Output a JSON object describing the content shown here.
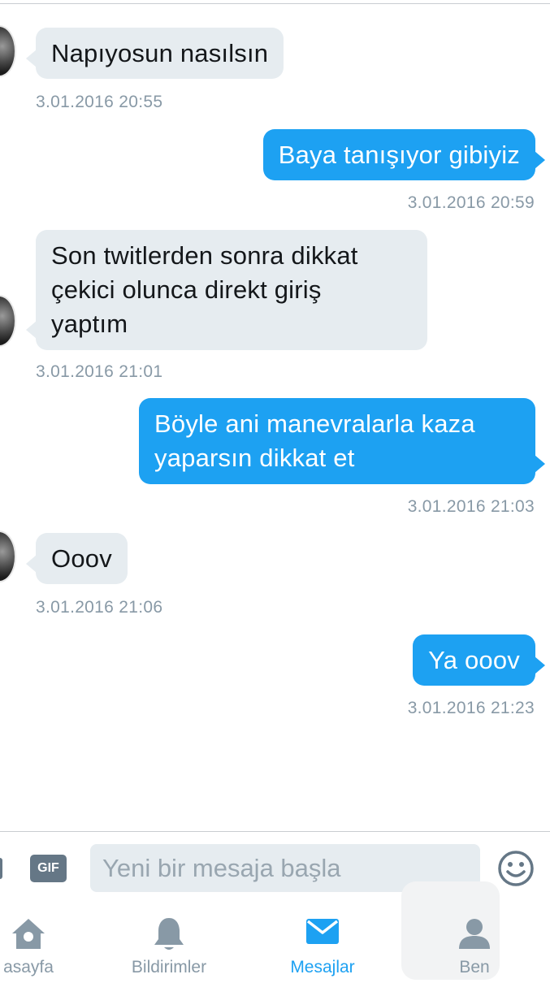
{
  "messages": [
    {
      "direction": "in",
      "lines": [
        "Napıyosun nasılsın"
      ],
      "time": "3.01.2016 20:55"
    },
    {
      "direction": "out",
      "lines": [
        "Baya tanışıyor gibiyiz"
      ],
      "time": "3.01.2016 20:59"
    },
    {
      "direction": "in",
      "lines": [
        "Son twitlerden sonra dikkat",
        "çekici olunca direkt giriş",
        "yaptım"
      ],
      "time": "3.01.2016 21:01"
    },
    {
      "direction": "out",
      "lines": [
        "Böyle ani manevralarla kaza",
        "yaparsın dikkat et"
      ],
      "time": "3.01.2016 21:03"
    },
    {
      "direction": "in",
      "lines": [
        "Ooov"
      ],
      "time": "3.01.2016 21:06"
    },
    {
      "direction": "out",
      "lines": [
        "Ya ooov"
      ],
      "time": "3.01.2016 21:23"
    }
  ],
  "composer": {
    "gif_label": "GIF",
    "placeholder": "Yeni bir mesaja başla",
    "emoji_icon": "smiley-icon"
  },
  "tabs": [
    {
      "label": "asayfa",
      "icon": "home-icon",
      "active": false
    },
    {
      "label": "Bildirimler",
      "icon": "bell-icon",
      "active": false
    },
    {
      "label": "Mesajlar",
      "icon": "envelope-icon",
      "active": true
    },
    {
      "label": "Ben",
      "icon": "person-icon",
      "active": false
    }
  ],
  "colors": {
    "accent": "#1da1f2",
    "incoming_bubble": "#e6ecf0",
    "muted_text": "#8899a6"
  }
}
